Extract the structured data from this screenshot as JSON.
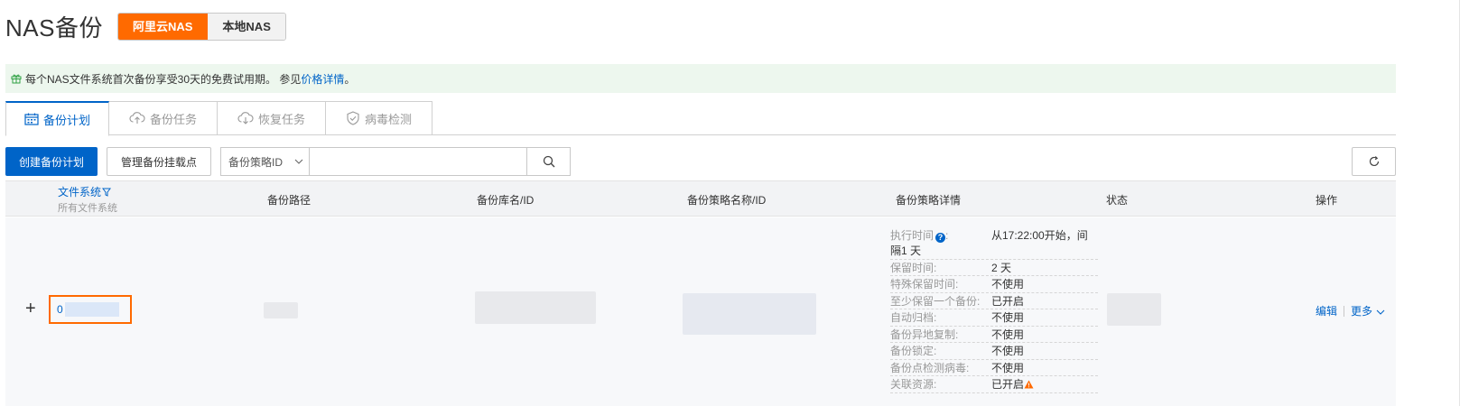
{
  "header": {
    "title": "NAS备份",
    "segments": [
      {
        "label": "阿里云NAS",
        "active": true
      },
      {
        "label": "本地NAS",
        "active": false
      }
    ]
  },
  "notice": {
    "text": "每个NAS文件系统首次备份享受30天的免费试用期。 参见",
    "link": "价格详情",
    "suffix": "。",
    "icon": "gift-icon"
  },
  "tabs": [
    {
      "label": "备份计划",
      "icon": "calendar-icon",
      "active": true
    },
    {
      "label": "备份任务",
      "icon": "cloud-upload-icon",
      "active": false
    },
    {
      "label": "恢复任务",
      "icon": "cloud-download-icon",
      "active": false
    },
    {
      "label": "病毒检测",
      "icon": "shield-check-icon",
      "active": false
    }
  ],
  "toolbar": {
    "create_label": "创建备份计划",
    "manage_label": "管理备份挂载点",
    "filter_select": "备份策略ID",
    "search_placeholder": ""
  },
  "table": {
    "columns": {
      "fs": "文件系统",
      "fs_sub": "所有文件系统",
      "path": "备份路径",
      "vault": "备份库名/ID",
      "policy": "备份策略名称/ID",
      "detail": "备份策略详情",
      "status": "状态",
      "ops": "操作"
    },
    "row": {
      "expand": "+",
      "fs_prefix": "0",
      "details": {
        "exec_key": "执行时间",
        "exec_val": "从17:22:00开始，间",
        "exec_cont": "隔1 天",
        "items": [
          {
            "k": "保留时间:",
            "v": "2 天"
          },
          {
            "k": "特殊保留时间:",
            "v": "不使用"
          },
          {
            "k": "至少保留一个备份:",
            "v": "已开启"
          },
          {
            "k": "自动归档:",
            "v": "不使用"
          },
          {
            "k": "备份异地复制:",
            "v": "不使用"
          },
          {
            "k": "备份锁定:",
            "v": "不使用"
          },
          {
            "k": "备份点检测病毒:",
            "v": "不使用"
          },
          {
            "k": "关联资源:",
            "v": "已开启"
          }
        ]
      },
      "ops": {
        "edit": "编辑",
        "more": "更多"
      }
    }
  },
  "colors": {
    "primary": "#0064c8",
    "accent": "#ff6a00",
    "notice_bg": "#edf7ee",
    "warning": "#ff6a00"
  }
}
